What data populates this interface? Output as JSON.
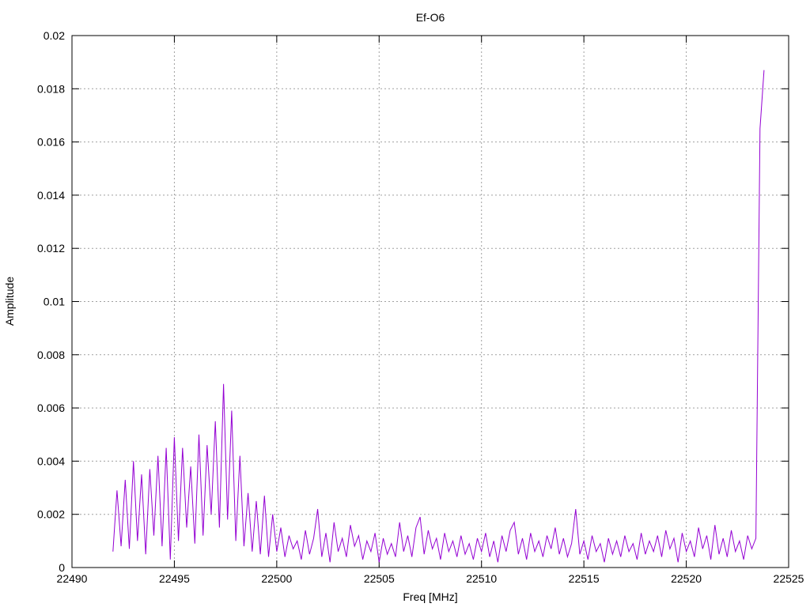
{
  "chart_data": {
    "type": "line",
    "title": "Ef-O6",
    "xlabel": "Freq [MHz]",
    "ylabel": "Amplitude",
    "xlim": [
      22490,
      22525
    ],
    "ylim": [
      0,
      0.02
    ],
    "xticks": [
      "22490",
      "22495",
      "22500",
      "22505",
      "22510",
      "22515",
      "22520",
      "22525"
    ],
    "yticks": [
      "0",
      "0.002",
      "0.004",
      "0.006",
      "0.008",
      "0.01",
      "0.012",
      "0.014",
      "0.016",
      "0.018",
      "0.02"
    ],
    "grid": true,
    "series": [
      {
        "name": "Ef-O6",
        "color": "#9400d3",
        "x_start": 22492.0,
        "x_step": 0.2,
        "values": [
          0.0006,
          0.0029,
          0.0008,
          0.0033,
          0.0007,
          0.004,
          0.001,
          0.0035,
          0.0005,
          0.0037,
          0.0012,
          0.0042,
          0.0008,
          0.0045,
          0.0003,
          0.0049,
          0.001,
          0.0045,
          0.0015,
          0.0038,
          0.0009,
          0.005,
          0.0012,
          0.0046,
          0.002,
          0.0055,
          0.0015,
          0.0069,
          0.0018,
          0.0059,
          0.001,
          0.0042,
          0.0008,
          0.0028,
          0.0006,
          0.0025,
          0.0005,
          0.0027,
          0.0004,
          0.002,
          0.0006,
          0.0015,
          0.0004,
          0.0012,
          0.0007,
          0.001,
          0.0003,
          0.0014,
          0.0005,
          0.0011,
          0.0022,
          0.0004,
          0.0013,
          0.0002,
          0.0017,
          0.0006,
          0.0011,
          0.0004,
          0.0016,
          0.0008,
          0.0012,
          0.0003,
          0.001,
          0.0006,
          0.0013,
          0.0002,
          0.0011,
          0.0005,
          0.0009,
          0.0004,
          0.0017,
          0.0006,
          0.0012,
          0.0004,
          0.0015,
          0.0019,
          0.0005,
          0.0014,
          0.0007,
          0.0011,
          0.0003,
          0.0013,
          0.0006,
          0.001,
          0.0004,
          0.0012,
          0.0005,
          0.0009,
          0.0003,
          0.0011,
          0.0006,
          0.0013,
          0.0004,
          0.001,
          0.0002,
          0.0012,
          0.0006,
          0.0014,
          0.0017,
          0.0005,
          0.0011,
          0.0003,
          0.0013,
          0.0006,
          0.001,
          0.0004,
          0.0012,
          0.0007,
          0.0015,
          0.0005,
          0.0011,
          0.0004,
          0.0009,
          0.0022,
          0.0005,
          0.001,
          0.0003,
          0.0012,
          0.0006,
          0.0009,
          0.0002,
          0.0011,
          0.0005,
          0.001,
          0.0004,
          0.0012,
          0.0006,
          0.0009,
          0.0003,
          0.0013,
          0.0005,
          0.001,
          0.0006,
          0.0012,
          0.0004,
          0.0014,
          0.0007,
          0.0011,
          0.0002,
          0.0013,
          0.0006,
          0.001,
          0.0004,
          0.0015,
          0.0007,
          0.0012,
          0.0003,
          0.0016,
          0.0005,
          0.0011,
          0.0004,
          0.0014,
          0.0006,
          0.001,
          0.0003,
          0.0012,
          0.0007,
          0.0011,
          0.0165,
          0.0187
        ]
      }
    ]
  }
}
